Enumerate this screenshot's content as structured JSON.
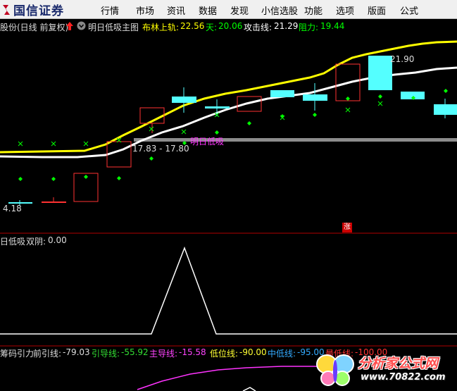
{
  "app": {
    "logo_text": "国信证券"
  },
  "menu": [
    "行情",
    "市场",
    "资讯",
    "数据",
    "发现",
    "小信选股",
    "功能",
    "选项",
    "版面",
    "公式"
  ],
  "main_info": {
    "stock_label": "股份(日线 前复权)",
    "indicator_name": "明日低吸主图",
    "boll_upper_label": "布林上轨:",
    "boll_upper_value": "22.56",
    "tian_label": "天:",
    "tian_value": "20.06",
    "attack_label": "攻击线:",
    "attack_value": "21.29",
    "resist_label": "阻力:",
    "resist_value": "19.44"
  },
  "main_chart": {
    "annotations": {
      "price_high": "21.90",
      "support_text": "17.83 - 17.80",
      "buy_text": "明日低吸",
      "price_low": "4.18",
      "zhang_badge": "涨"
    }
  },
  "sub1": {
    "title": "日低吸",
    "label": "双阴:",
    "value": "0.00"
  },
  "sub2": {
    "title": "筹码引力",
    "items": [
      {
        "label": "前引线:",
        "value": "-79.03",
        "color": "#dddddd"
      },
      {
        "label": "引导线:",
        "value": "-55.92",
        "color": "#33dd33"
      },
      {
        "label": "主导线:",
        "value": "-15.58",
        "color": "#ff44ff"
      },
      {
        "label": "低位线:",
        "value": "-90.00",
        "color": "#ffff33"
      },
      {
        "label": "中低线:",
        "value": "-95.00",
        "color": "#33aaff"
      },
      {
        "label": "最低线:",
        "value": "-100.00",
        "color": "#ff3333"
      }
    ]
  },
  "watermark": {
    "text": "分析家公式网",
    "url": "www.70822.com"
  },
  "colors": {
    "up_candle": "#ff3232",
    "down_candle": "#54ffff",
    "boll_upper": "#ffff00",
    "mid_line": "#ffffff",
    "signal_green": "#00ff00",
    "buy_label": "#ff33ff"
  }
}
